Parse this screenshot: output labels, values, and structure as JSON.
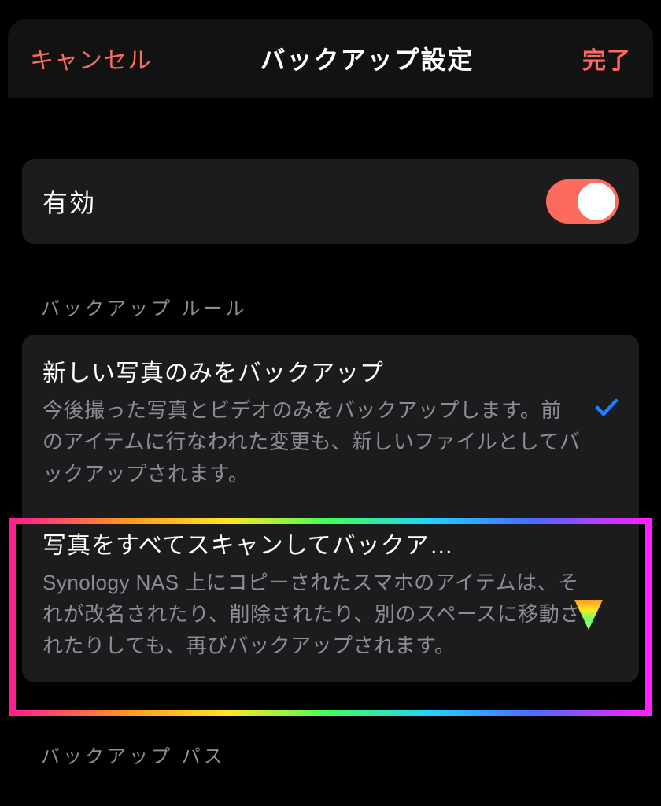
{
  "header": {
    "cancel": "キャンセル",
    "title": "バックアップ設定",
    "done": "完了"
  },
  "enable_row": {
    "label": "有効",
    "value": true
  },
  "rule_section": {
    "heading": "バックアップ ルール",
    "options": [
      {
        "title": "新しい写真のみをバックアップ",
        "description": "今後撮った写真とビデオのみをバックアップします。前のアイテムに行なわれた変更も、新しいファイルとしてバックアップされます。",
        "selected": true
      },
      {
        "title": "写真をすべてスキャンしてバックア…",
        "description": "Synology NAS 上にコピーされたスマホのアイテムは、それが改名されたり、削除されたり、別のスペースに移動されたりしても、再びバックアップされます。",
        "selected": false
      }
    ]
  },
  "path_section": {
    "heading": "バックアップ パス"
  },
  "colors": {
    "accent": "#fd6a5e",
    "check": "#1e7fff"
  }
}
